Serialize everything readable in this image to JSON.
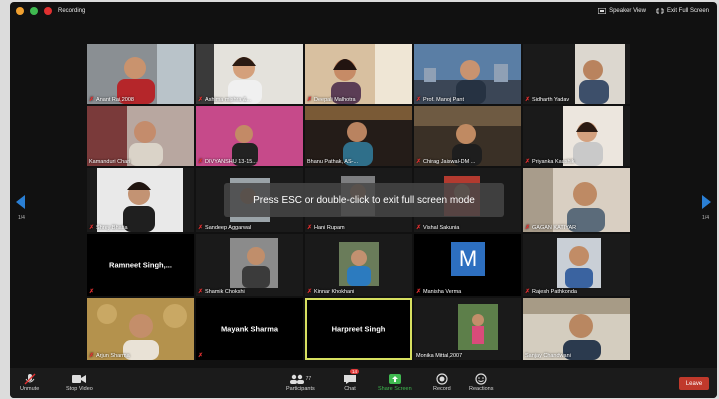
{
  "topbar": {
    "recording_label": "Recording",
    "speaker_view_label": "Speaker View",
    "exit_full_screen_label": "Exit Full Screen"
  },
  "overlay": {
    "esc_message": "Press ESC or double-click to exit full screen mode"
  },
  "pagination": {
    "left": "1/4",
    "right": "1/4"
  },
  "participants": [
    {
      "name": "Anant Rai,2008",
      "muted": true
    },
    {
      "name": "Ashima mishra &...",
      "muted": true
    },
    {
      "name": "Deepali Malhotra",
      "muted": true
    },
    {
      "name": "Prof. Manoj Pant",
      "muted": true
    },
    {
      "name": "Sidharth Yadav",
      "muted": true
    },
    {
      "name": "Kamanduri Chari",
      "muted": false
    },
    {
      "name": "DIVYANSHU 13-15...",
      "muted": false
    },
    {
      "name": "Bhanu Pathak, AS-...",
      "muted": true
    },
    {
      "name": "Chirag Jaiswal-DM ...",
      "muted": true
    },
    {
      "name": "Priyanka Kaushik",
      "muted": true
    },
    {
      "name": "Shrey Bhatia",
      "muted": true
    },
    {
      "name": "Sandeep Aggarwal",
      "muted": true
    },
    {
      "name": "Hani Rupam",
      "muted": true
    },
    {
      "name": "Vishal Sakunia",
      "muted": true
    },
    {
      "name": "GAGAN KATIYAR",
      "muted": true
    },
    {
      "name": "Ramneet Singh,...",
      "muted": false
    },
    {
      "name": "Shamik Chokshi",
      "muted": true
    },
    {
      "name": "Kinnar Khokhani",
      "muted": true
    },
    {
      "name": "Manisha Verma",
      "muted": true
    },
    {
      "name": "Rajesh Pathkonda",
      "muted": true
    },
    {
      "name": "Arjun Sharma",
      "muted": true
    },
    {
      "name": "Mayank Sharma",
      "muted": true
    },
    {
      "name": "Harpreet Singh",
      "muted": false
    },
    {
      "name": "Monika Mittal,2007",
      "muted": false
    },
    {
      "name": "Sanjay Chandwani",
      "muted": false
    }
  ],
  "avatar_letter": "M",
  "toolbar": {
    "unmute": "Unmute",
    "stop_video": "Stop Video",
    "participants": "Participants",
    "participants_count": "77",
    "chat": "Chat",
    "chat_badge": "14",
    "share_screen": "Share Screen",
    "record": "Record",
    "reactions": "Reactions",
    "leave": "Leave"
  },
  "colors": {
    "accent": "#2a7fd4",
    "active_speaker": "#d7e060",
    "leave": "#c0392b",
    "share_screen": "#3fb950",
    "muted_icon": "#e03030"
  }
}
